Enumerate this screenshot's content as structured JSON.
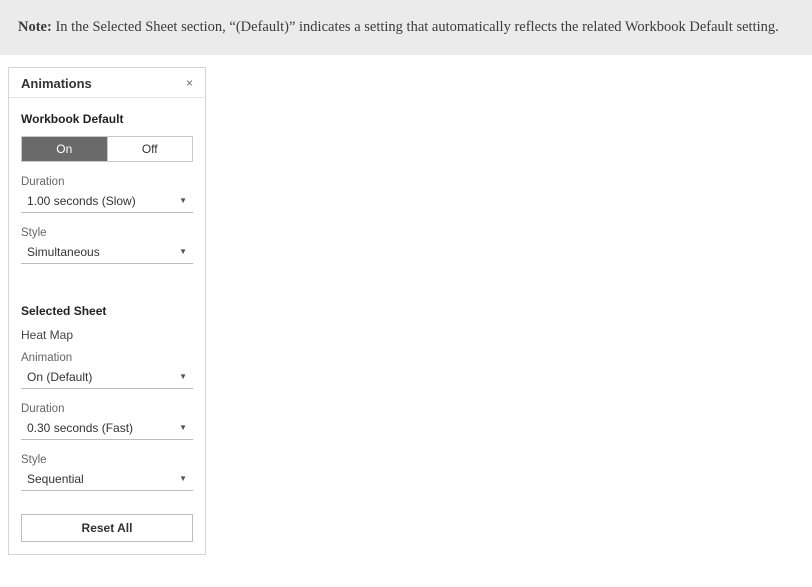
{
  "note": {
    "label": "Note:",
    "text": " In the Selected Sheet section, “(Default)” indicates a setting that automatically reflects the related Workbook Default setting."
  },
  "panel": {
    "title": "Animations",
    "close": "×",
    "workbook": {
      "heading": "Workbook Default",
      "toggle_on": "On",
      "toggle_off": "Off",
      "duration_label": "Duration",
      "duration_value": "1.00 seconds (Slow)",
      "style_label": "Style",
      "style_value": "Simultaneous"
    },
    "sheet": {
      "heading": "Selected Sheet",
      "name": "Heat Map",
      "animation_label": "Animation",
      "animation_value": "On (Default)",
      "duration_label": "Duration",
      "duration_value": "0.30 seconds (Fast)",
      "style_label": "Style",
      "style_value": "Sequential"
    },
    "reset": "Reset All"
  }
}
